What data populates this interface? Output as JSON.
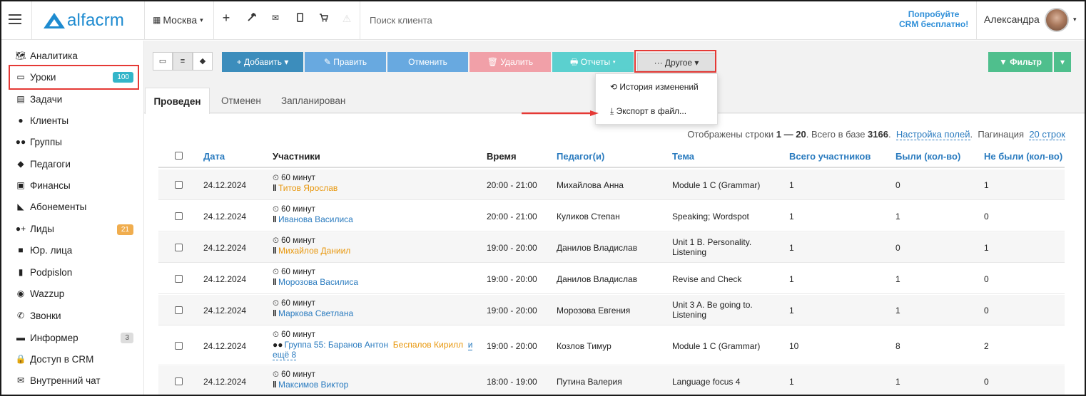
{
  "topbar": {
    "logo_text": "alfacrm",
    "city": "Москва",
    "search_placeholder": "Поиск клиента",
    "try_line1": "Попробуйте",
    "try_line2": "CRM бесплатно!",
    "user_name": "Александра"
  },
  "sidebar": {
    "items": [
      {
        "label": "Аналитика",
        "icon": "map-icon"
      },
      {
        "label": "Уроки",
        "icon": "calendar-icon",
        "badge": "100"
      },
      {
        "label": "Задачи",
        "icon": "clipboard-icon"
      },
      {
        "label": "Клиенты",
        "icon": "user-icon"
      },
      {
        "label": "Группы",
        "icon": "users-icon"
      },
      {
        "label": "Педагоги",
        "icon": "graduation-cap-icon"
      },
      {
        "label": "Финансы",
        "icon": "money-icon"
      },
      {
        "label": "Абонементы",
        "icon": "tag-icon"
      },
      {
        "label": "Лиды",
        "icon": "user-plus-icon",
        "badge": "21"
      },
      {
        "label": "Юр. лица",
        "icon": "briefcase-icon"
      },
      {
        "label": "Podpislon",
        "icon": "file-icon"
      },
      {
        "label": "Wazzup",
        "icon": "whatsapp-icon"
      },
      {
        "label": "Звонки",
        "icon": "phone-icon"
      },
      {
        "label": "Информер",
        "icon": "book-icon",
        "badge": "3"
      },
      {
        "label": "Доступ в CRM",
        "icon": "lock-icon"
      },
      {
        "label": "Внутренний чат",
        "icon": "envelope-icon"
      }
    ]
  },
  "toolbar": {
    "add": "+ Добавить ▾",
    "edit": "✎ Править",
    "cancel": "Отменить",
    "delete": "🗑 Удалить",
    "reports": "🖶 Отчеты ▾",
    "other": "··· Другое ▾",
    "filter": "▼ Фильтр",
    "filter_caret": "▾"
  },
  "tabs": [
    "Проведен",
    "Отменен",
    "Запланирован"
  ],
  "info": {
    "prefix": "Отображены строки ",
    "range": "1 — 20",
    "mid": ". Всего в базе ",
    "total": "3166",
    "dot": ".",
    "settings_link": "Настройка полей",
    "pagination_label": "Пагинация",
    "pagination_link": "20 строк"
  },
  "dropdown": {
    "history": "⟲ История изменений",
    "export": "⤓ Экспорт в файл..."
  },
  "table": {
    "headers": {
      "date": "Дата",
      "participants": "Участники",
      "time": "Время",
      "teacher": "Педагог(и)",
      "topic": "Тема",
      "total": "Всего участников",
      "present": "Были (кол-во)",
      "absent": "Не были (кол-во)"
    },
    "rows": [
      {
        "date": "24.12.2024",
        "duration": "⏲ 60 минут",
        "participant": "Титов Ярослав",
        "pcolor": "orange",
        "time": "20:00 - 21:00",
        "teacher": "Михайлова Анна",
        "topic": "Module 1 C (Grammar)",
        "total": "1",
        "present": "0",
        "absent": "1"
      },
      {
        "date": "24.12.2024",
        "duration": "⏲ 60 минут",
        "participant": "Иванова Василиса",
        "pcolor": "blue",
        "time": "20:00 - 21:00",
        "teacher": "Куликов Степан",
        "topic": "Speaking; Wordspot",
        "total": "1",
        "present": "1",
        "absent": "0"
      },
      {
        "date": "24.12.2024",
        "duration": "⏲ 60 минут",
        "participant": "Михайлов Даниил",
        "pcolor": "orange",
        "time": "19:00 - 20:00",
        "teacher": "Данилов Владислав",
        "topic": "Unit 1 B. Personality. Listening",
        "total": "1",
        "present": "0",
        "absent": "1"
      },
      {
        "date": "24.12.2024",
        "duration": "⏲ 60 минут",
        "participant": "Морозова Василиса",
        "pcolor": "blue",
        "time": "19:00 - 20:00",
        "teacher": "Данилов Владислав",
        "topic": "Revise and Check",
        "total": "1",
        "present": "1",
        "absent": "0"
      },
      {
        "date": "24.12.2024",
        "duration": "⏲ 60 минут",
        "participant": "Маркова Светлана",
        "pcolor": "blue",
        "time": "19:00 - 20:00",
        "teacher": "Морозова Евгения",
        "topic": "Unit 3 A. Be going to. Listening",
        "total": "1",
        "present": "1",
        "absent": "0"
      },
      {
        "date": "24.12.2024",
        "duration": "⏲ 60 минут",
        "group": "Группа 55: Баранов Антон",
        "extra": "Беспалов Кирилл",
        "more_and": "и",
        "more_rest": "ещё 8",
        "time": "19:00 - 20:00",
        "teacher": "Козлов Тимур",
        "topic": "Module 1 C (Grammar)",
        "total": "10",
        "present": "8",
        "absent": "2"
      },
      {
        "date": "24.12.2024",
        "duration": "⏲ 60 минут",
        "participant": "Максимов Виктор",
        "pcolor": "blue",
        "time": "18:00 - 19:00",
        "teacher": "Путина Валерия",
        "topic": "Language focus 4",
        "total": "1",
        "present": "1",
        "absent": "0"
      }
    ]
  },
  "colors": {
    "accent": "#2a7bbf",
    "highlight": "#e53935",
    "orange": "#e8970c"
  }
}
